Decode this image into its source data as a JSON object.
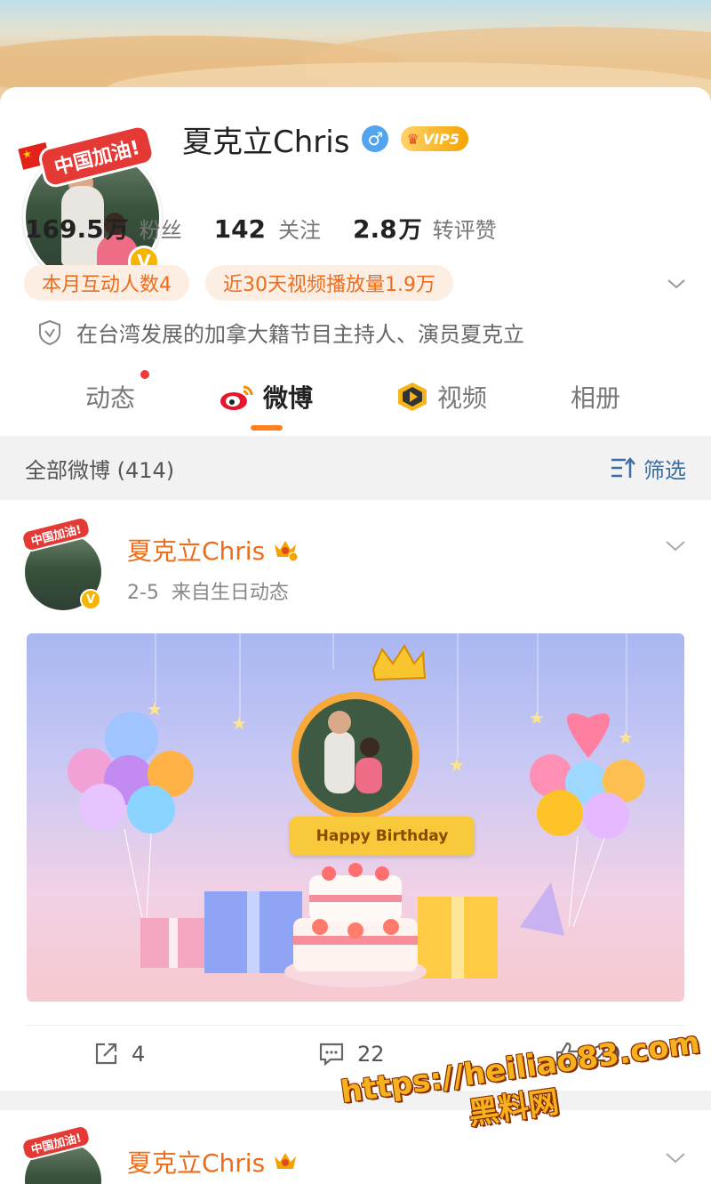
{
  "profile": {
    "avatar_badge": "中国加油!",
    "verified_mark": "V",
    "name": "夏克立Chris",
    "gender_symbol": "♂",
    "vip_label": "VIP5",
    "stats": [
      {
        "number": "169.5",
        "unit": "万",
        "label": "粉丝"
      },
      {
        "number": "142",
        "unit": "",
        "label": "关注"
      },
      {
        "number": "2.8",
        "unit": "万",
        "label": "转评赞"
      }
    ],
    "pills": [
      "本月互动人数4",
      "近30天视频播放量1.9万"
    ],
    "description": "在台湾发展的加拿大籍节目主持人、演员夏克立"
  },
  "tabs": [
    {
      "label": "动态",
      "has_dot": true
    },
    {
      "label": "微博",
      "active": true
    },
    {
      "label": "视频"
    },
    {
      "label": "相册"
    }
  ],
  "filter": {
    "title": "全部微博 (414)",
    "button_label": "筛选"
  },
  "posts": [
    {
      "author": "夏克立Chris",
      "meta": "2-5  来自生日动态",
      "image_text": "Happy Birthday",
      "actions": [
        {
          "icon": "share-icon",
          "count": "4"
        },
        {
          "icon": "comment-icon",
          "count": "22"
        },
        {
          "icon": "like-icon",
          "count": "29"
        }
      ]
    },
    {
      "author": "夏克立Chris"
    }
  ],
  "watermark": {
    "line1": "https://heiliao83.com",
    "line2": "黑料网"
  },
  "colors": {
    "accent_orange": "#ee6c1a",
    "filter_blue": "#3a6ea5",
    "vip_gold": "#f4a400",
    "verified_yellow": "#f7b500"
  }
}
